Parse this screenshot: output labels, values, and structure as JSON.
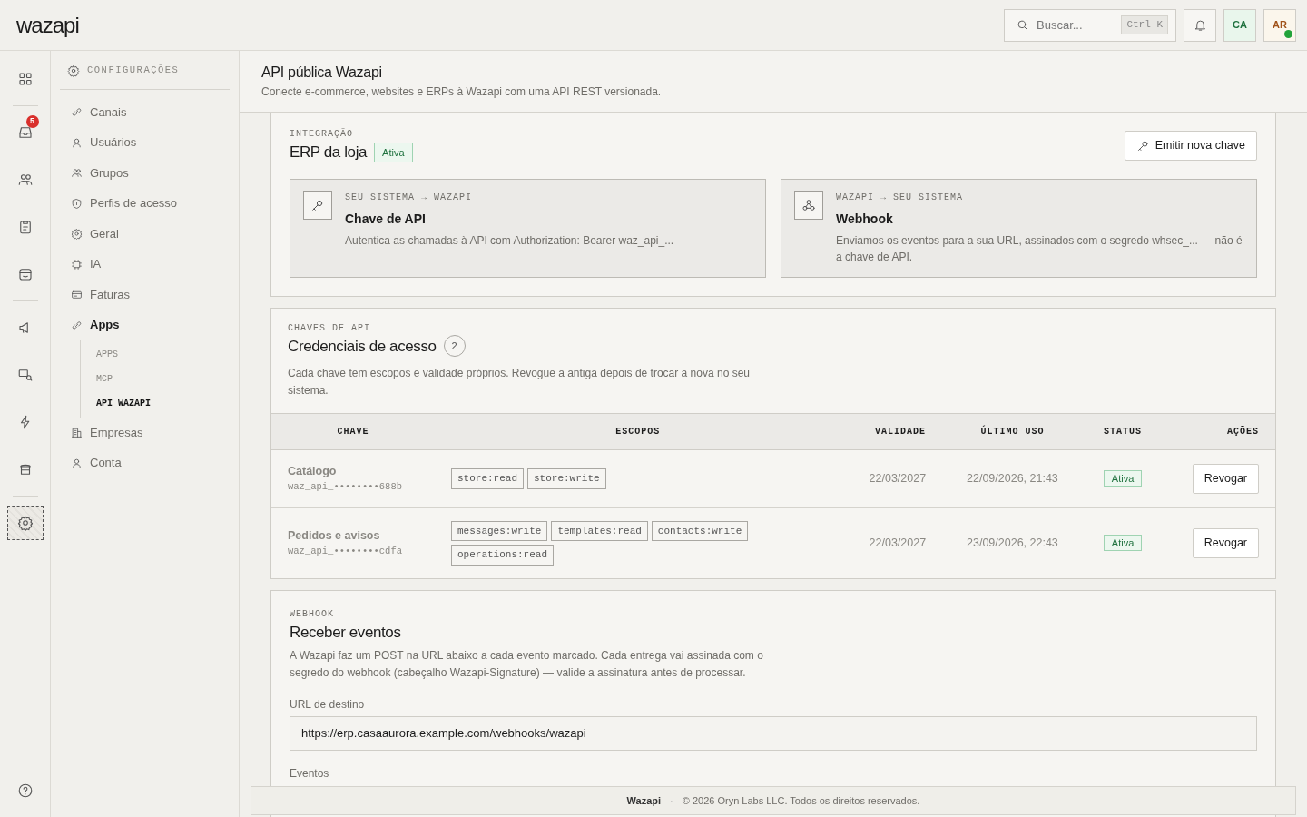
{
  "topbar": {
    "logo": "wazapi",
    "search": {
      "placeholder": "Buscar...",
      "shortcut": "Ctrl K"
    },
    "avatars": [
      {
        "initials": "CA",
        "online": false
      },
      {
        "initials": "AR",
        "online": true
      }
    ]
  },
  "rail": {
    "items": [
      {
        "selected": false
      },
      {
        "selected": false,
        "badge": "5"
      },
      {
        "selected": false
      },
      {
        "selected": false
      },
      {
        "selected": false
      },
      {
        "selected": false
      },
      {
        "selected": false
      },
      {
        "selected": false
      },
      {
        "selected": false
      },
      {
        "selected": true
      }
    ]
  },
  "sidebar": {
    "heading": "CONFIGURAÇÕES",
    "items": [
      {
        "label": "Canais",
        "selected": false
      },
      {
        "label": "Usuários",
        "selected": false
      },
      {
        "label": "Grupos",
        "selected": false
      },
      {
        "label": "Perfis de acesso",
        "selected": false
      },
      {
        "label": "Geral",
        "selected": false
      },
      {
        "label": "IA",
        "selected": false
      },
      {
        "label": "Faturas",
        "selected": false
      },
      {
        "label": "Apps",
        "selected": true,
        "expanded": true,
        "children": [
          {
            "label": "APPS",
            "selected": false
          },
          {
            "label": "MCP",
            "selected": false
          },
          {
            "label": "API WAZAPI",
            "selected": true
          }
        ]
      },
      {
        "label": "Empresas",
        "selected": false
      },
      {
        "label": "Conta",
        "selected": false
      }
    ]
  },
  "page": {
    "title": "API pública Wazapi",
    "subtitle": "Conecte e-commerce, websites e ERPs à Wazapi com uma API REST versionada."
  },
  "integration": {
    "eyebrow": "INTEGRAÇÃO",
    "title": "ERP da loja",
    "status": "Ativa",
    "button": "Emitir nova chave",
    "cards": [
      {
        "eyebrow": "SEU SISTEMA → WAZAPI",
        "title": "Chave de API",
        "text": "Autentica as chamadas à API com Authorization: Bearer waz_api_..."
      },
      {
        "eyebrow": "WAZAPI → SEU SISTEMA",
        "title": "Webhook",
        "text": "Enviamos os eventos para a sua URL, assinados com o segredo whsec_... — não é a chave de API."
      }
    ]
  },
  "credentials": {
    "eyebrow": "CHAVES DE API",
    "title": "Credenciais de acesso",
    "count": "2",
    "text": "Cada chave tem escopos e validade próprios. Revogue a antiga depois de trocar a nova no seu sistema.",
    "table": {
      "columns": [
        "CHAVE",
        "ESCOPOS",
        "VALIDADE",
        "ÚLTIMO USO",
        "STATUS",
        "AÇÕES"
      ],
      "rows": [
        {
          "name": "Catálogo",
          "key": "waz_api_••••••••688b",
          "scopes": [
            "store:read",
            "store:write"
          ],
          "validity": "22/03/2027",
          "last_used": "22/09/2026, 21:43",
          "status": "Ativa",
          "action": "Revogar"
        },
        {
          "name": "Pedidos e avisos",
          "key": "waz_api_••••••••cdfa",
          "scopes": [
            "messages:write",
            "templates:read",
            "contacts:write",
            "operations:read"
          ],
          "validity": "22/03/2027",
          "last_used": "23/09/2026, 22:43",
          "status": "Ativa",
          "action": "Revogar"
        }
      ]
    }
  },
  "webhook": {
    "eyebrow": "WEBHOOK",
    "title": "Receber eventos",
    "text": "A Wazapi faz um POST na URL abaixo a cada evento marcado. Cada entrega vai assinada com o segredo do webhook (cabeçalho Wazapi-Signature) — valide a assinatura antes de processar.",
    "url_label": "URL de destino",
    "url": "https://erp.casaaurora.example.com/webhooks/wazapi",
    "events_label": "Eventos"
  },
  "footer": {
    "brand": "Wazapi",
    "separator": "·",
    "text": "© 2026 Oryn Labs LLC. Todos os direitos reservados."
  }
}
